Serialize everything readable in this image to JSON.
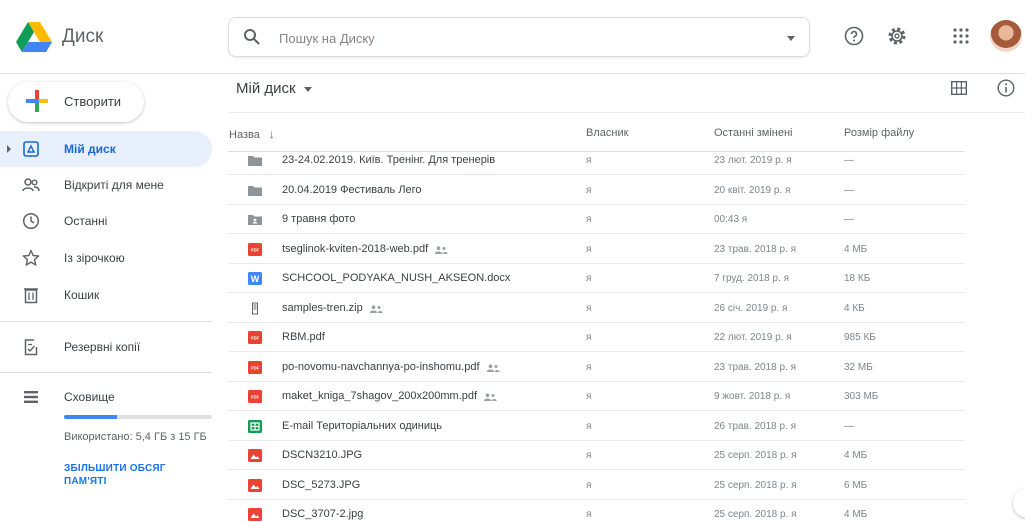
{
  "app": {
    "name": "Диск"
  },
  "search": {
    "placeholder": "Пошук на Диску"
  },
  "sidebar": {
    "create_label": "Створити",
    "items": [
      {
        "key": "my-drive",
        "label": "Мій диск",
        "icon": "drive-icon",
        "active": true
      },
      {
        "key": "shared",
        "label": "Відкриті для мене",
        "icon": "people-icon",
        "active": false
      },
      {
        "key": "recent",
        "label": "Останні",
        "icon": "clock-icon",
        "active": false
      },
      {
        "key": "starred",
        "label": "Із зірочкою",
        "icon": "star-icon",
        "active": false
      },
      {
        "key": "trash",
        "label": "Кошик",
        "icon": "trash-icon",
        "active": false
      },
      {
        "key": "backups",
        "label": "Резервні копії",
        "icon": "backup-icon",
        "active": false
      },
      {
        "key": "storage",
        "label": "Сховище",
        "icon": "storage-icon",
        "active": false
      }
    ],
    "storage": {
      "used_text": "Використано: 5,4 ГБ з 15 ГБ",
      "used_fraction": 0.36,
      "upgrade_label": "ЗБІЛЬШИТИ ОБСЯГ ПАМ'ЯТІ"
    }
  },
  "main": {
    "title": "Мій диск",
    "columns": {
      "name": "Назва",
      "owner": "Власник",
      "modified": "Останні змінені",
      "size": "Розмір файлу"
    },
    "files": [
      {
        "name": "23-24.02.2019. Київ. Тренінг. Для тренерів",
        "type": "folder",
        "shared": false,
        "owner": "я",
        "modified": "23 лют. 2019 р. я",
        "size": "—"
      },
      {
        "name": "20.04.2019 Фестиваль Лего",
        "type": "folder",
        "shared": false,
        "owner": "я",
        "modified": "20 квіт. 2019 р. я",
        "size": "—"
      },
      {
        "name": "9 травня фото",
        "type": "shared-folder",
        "shared": false,
        "owner": "я",
        "modified": "00:43 я",
        "size": "—"
      },
      {
        "name": "tseglinok-kviten-2018-web.pdf",
        "type": "pdf",
        "shared": true,
        "owner": "я",
        "modified": "23 трав. 2018 р. я",
        "size": "4 МБ"
      },
      {
        "name": "SCHCOOL_PODYAKA_NUSH_AKSEON.docx",
        "type": "doc",
        "shared": false,
        "owner": "я",
        "modified": "7 груд. 2018 р. я",
        "size": "18 КБ"
      },
      {
        "name": "samples-tren.zip",
        "type": "zip",
        "shared": true,
        "owner": "я",
        "modified": "26 січ. 2019 р. я",
        "size": "4 КБ"
      },
      {
        "name": "RBM.pdf",
        "type": "pdf",
        "shared": false,
        "owner": "я",
        "modified": "22 лют. 2019 р. я",
        "size": "985 КБ"
      },
      {
        "name": "po-novomu-navchannya-po-inshomu.pdf",
        "type": "pdf",
        "shared": true,
        "owner": "я",
        "modified": "23 трав. 2018 р. я",
        "size": "32 МБ"
      },
      {
        "name": "maket_kniga_7shagov_200x200mm.pdf",
        "type": "pdf",
        "shared": true,
        "owner": "я",
        "modified": "9 жовт. 2018 р. я",
        "size": "303 МБ"
      },
      {
        "name": "E-mail Територіальних одиниць",
        "type": "sheet",
        "shared": false,
        "owner": "я",
        "modified": "26 трав. 2018 р. я",
        "size": "—"
      },
      {
        "name": "DSCN3210.JPG",
        "type": "image",
        "shared": false,
        "owner": "я",
        "modified": "25 серп. 2018 р. я",
        "size": "4 МБ"
      },
      {
        "name": "DSC_5273.JPG",
        "type": "image",
        "shared": false,
        "owner": "я",
        "modified": "25 серп. 2018 р. я",
        "size": "6 МБ"
      },
      {
        "name": "DSC_3707-2.jpg",
        "type": "image",
        "shared": false,
        "owner": "я",
        "modified": "25 серп. 2018 р. я",
        "size": "4 МБ"
      }
    ]
  },
  "colors": {
    "accent": "#1a73e8",
    "active_bg": "#e8f0fe",
    "pdf": "#ea4335",
    "doc": "#4285f4",
    "sheet": "#0f9d58",
    "folder": "#8f9499"
  }
}
